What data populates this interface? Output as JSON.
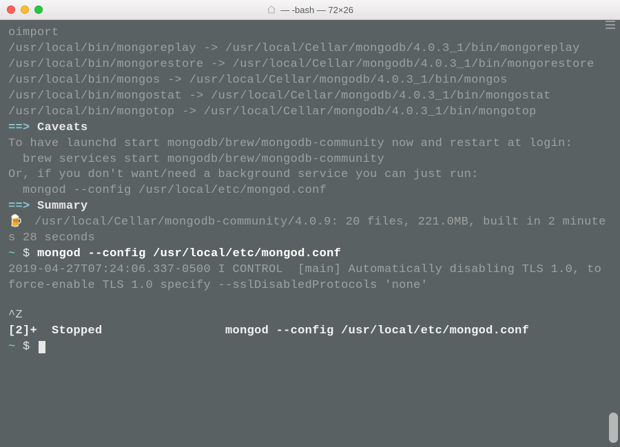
{
  "window": {
    "title": "— -bash — 72×26"
  },
  "symbols": {
    "arrow": "==>",
    "link_arrow": "->",
    "ctrlz": "^Z",
    "beer": "🍺"
  },
  "links": [
    {
      "left": "oimport",
      "right": ""
    },
    {
      "left": "/usr/local/bin/mongoreplay",
      "right": "/usr/local/Cellar/mongodb/4.0.3_1/bin/mongoreplay"
    },
    {
      "left": "/usr/local/bin/mongorestore",
      "right": "/usr/local/Cellar/mongodb/4.0.3_1/bin/mongorestore"
    },
    {
      "left": "/usr/local/bin/mongos",
      "right": "/usr/local/Cellar/mongodb/4.0.3_1/bin/mongos"
    },
    {
      "left": "/usr/local/bin/mongostat",
      "right": "/usr/local/Cellar/mongodb/4.0.3_1/bin/mongostat"
    },
    {
      "left": "/usr/local/bin/mongotop",
      "right": "/usr/local/Cellar/mongodb/4.0.3_1/bin/mongotop"
    }
  ],
  "caveats": {
    "heading": "Caveats",
    "line1": "To have launchd start mongodb/brew/mongodb-community now and restart at login:",
    "cmd1": "  brew services start mongodb/brew/mongodb-community",
    "line2": "Or, if you don't want/need a background service you can just run:",
    "cmd2": "  mongod --config /usr/local/etc/mongod.conf"
  },
  "summary": {
    "heading": "Summary",
    "text": "  /usr/local/Cellar/mongodb-community/4.0.9: 20 files, 221.0MB, built in 2 minutes 28 seconds"
  },
  "prompt1": {
    "tilde": "~",
    "dollar": "$",
    "cmd": "mongod --config /usr/local/etc/mongod.conf"
  },
  "logline": "2019-04-27T07:24:06.337-0500 I CONTROL  [main] Automatically disabling TLS 1.0, to force-enable TLS 1.0 specify --sslDisabledProtocols 'none'",
  "stopped": {
    "job": "[2]+  Stopped",
    "cmd": "                 mongod --config /usr/local/etc/mongod.conf"
  },
  "prompt2": {
    "tilde": "~",
    "dollar": "$"
  }
}
